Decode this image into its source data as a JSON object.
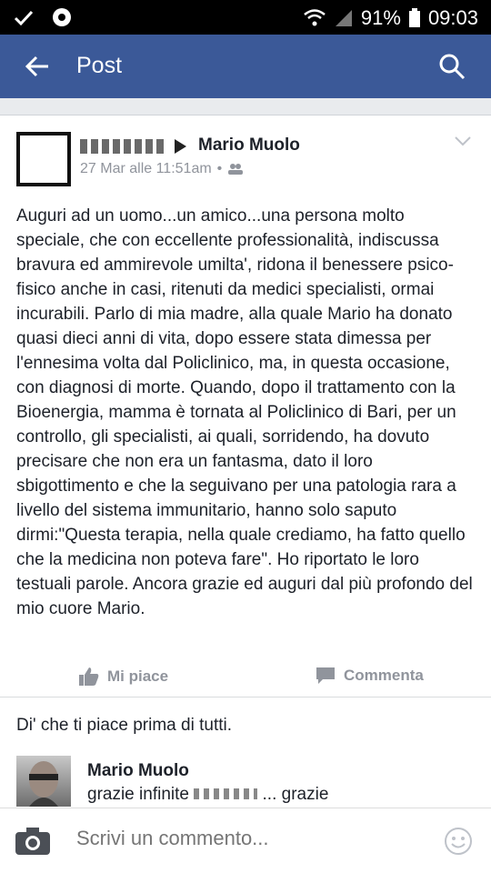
{
  "status": {
    "battery": "91%",
    "time": "09:03"
  },
  "appbar": {
    "title": "Post"
  },
  "post": {
    "author": "Mario Muolo",
    "timestamp": "27 Mar alle 11:51am",
    "separator": "•",
    "text": "Auguri ad un uomo...un amico...una persona molto speciale, che con eccellente  professionalità, indiscussa bravura ed ammirevole umilta', ridona il benessere psico-fisico anche in casi, ritenuti da medici specialisti, ormai incurabili. Parlo di mia madre, alla quale Mario ha donato quasi dieci anni di vita, dopo essere stata dimessa per l'ennesima volta dal Policlinico, ma, in questa occasione, con diagnosi di morte. Quando, dopo il trattamento con la Bioenergia, mamma è tornata al Policlinico di Bari, per un controllo, gli specialisti, ai quali, sorridendo, ha dovuto precisare che non era un fantasma, dato il loro sbigottimento e che la seguivano per una patologia rara a livello del sistema immunitario, hanno solo saputo dirmi:\"Questa terapia, nella quale crediamo, ha fatto quello che la medicina non poteva fare\". Ho riportato le loro testuali parole. Ancora grazie ed auguri dal più profondo del mio cuore Mario.",
    "actions": {
      "like": "Mi piace",
      "comment": "Commenta"
    }
  },
  "comments": {
    "first_like_prompt": "Di' che ti piace prima di tutti.",
    "items": [
      {
        "name": "Mario Muolo",
        "text_prefix": "grazie infinite",
        "text_suffix": "... grazie"
      }
    ]
  },
  "composer": {
    "placeholder": "Scrivi un commento..."
  }
}
